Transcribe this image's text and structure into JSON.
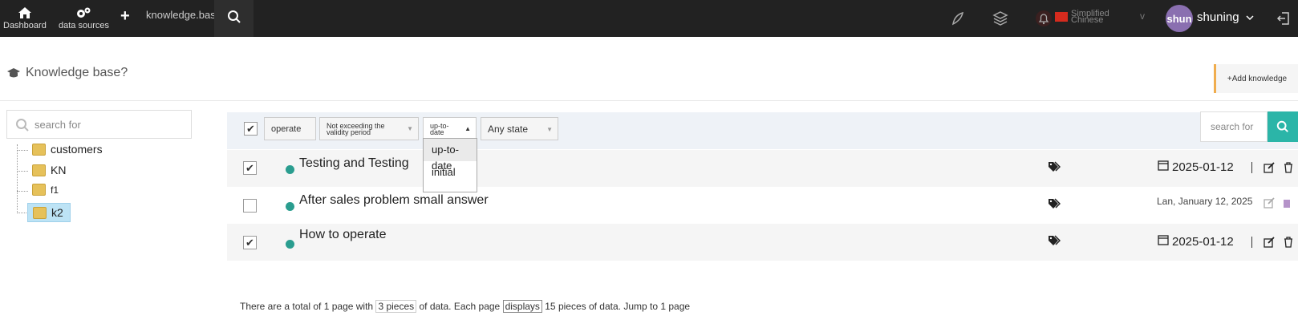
{
  "topbar": {
    "dashboard_label": "Dashboard",
    "datasources_label": "data sources",
    "add_label": "+",
    "kb_label": "knowledge.base",
    "lang_line1": "Simplified",
    "lang_line2": "Chinese",
    "lang_v": "v",
    "avatar_text": "shun",
    "user_name": "shuning"
  },
  "page": {
    "title": "Knowledge base?",
    "add_button": "+Add knowledge"
  },
  "sidebar": {
    "search_placeholder": "search for",
    "tree": [
      {
        "label": "customers"
      },
      {
        "label": "KN"
      },
      {
        "label": "f1"
      },
      {
        "label": "k2"
      }
    ]
  },
  "filters": {
    "operate": "operate",
    "validity_line1": "Not exceeding the",
    "validity_line2": "validity period",
    "version_line1": "up-to-",
    "version_line2": "date",
    "state": "Any state",
    "dropdown_options": [
      "up-to-date",
      "initial"
    ],
    "search_placeholder": "search for"
  },
  "rows": [
    {
      "title": "Testing and Testing",
      "date": "2025-01-12",
      "checked": "✔"
    },
    {
      "title": "After sales problem small answer",
      "date": "Lan, January 12, 2025",
      "checked": ""
    },
    {
      "title": "How to operate",
      "date": "2025-01-12",
      "checked": "✔"
    }
  ],
  "pager": {
    "p1": "There are a total of 1 page with ",
    "p2": "3 pieces",
    "p3": " of data. Each page ",
    "p4": "displays",
    "p5": " 15 pieces of data. Jump to 1 page"
  },
  "colors": {
    "topbar": "#222222",
    "accent": "#2bb5a8",
    "add_border": "#f0ad4e"
  }
}
